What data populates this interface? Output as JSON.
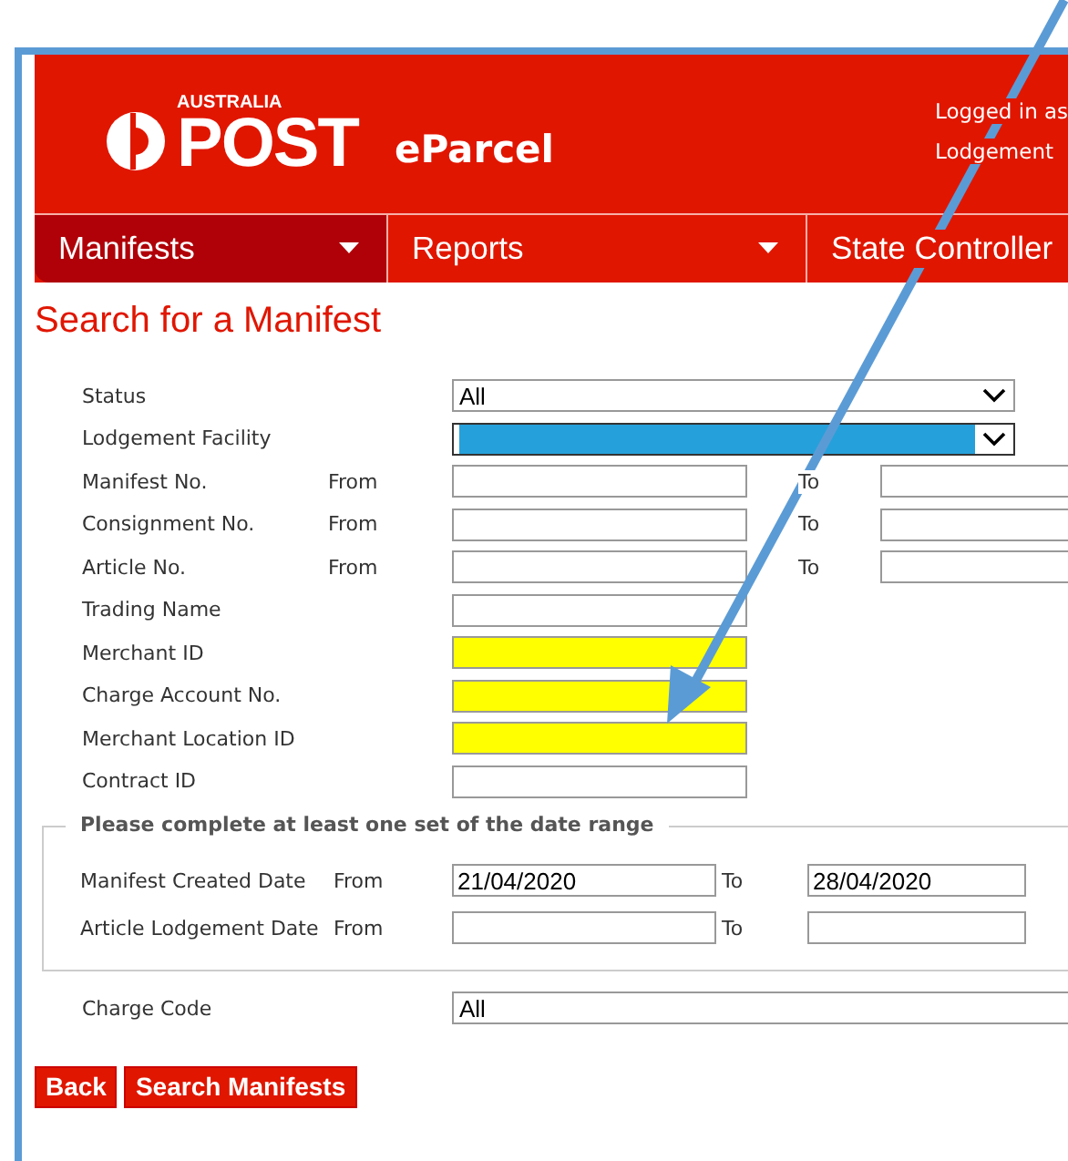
{
  "header": {
    "logo_small": "AUSTRALIA",
    "logo_main": "POST",
    "product": "eParcel",
    "user_lines": [
      "Logged in as",
      "Lodgement"
    ]
  },
  "nav": [
    {
      "label": "Manifests",
      "selected": true,
      "dropdown": true
    },
    {
      "label": "Reports",
      "selected": false,
      "dropdown": true
    },
    {
      "label": "State Controller",
      "selected": false
    }
  ],
  "title": "Search for a Manifest",
  "fields": [
    {
      "kind": "select",
      "label": "Status",
      "value": "All",
      "focused": false
    },
    {
      "kind": "select",
      "label": "Lodgement Facility",
      "focused": true
    },
    {
      "kind": "range",
      "label": "Manifest No.",
      "from": "From",
      "to": "To"
    },
    {
      "kind": "range",
      "label": "Consignment No.",
      "from": "From",
      "to": "To"
    },
    {
      "kind": "range",
      "label": "Article No.",
      "from": "From",
      "to": "To"
    },
    {
      "kind": "text",
      "label": "Trading Name",
      "highlighted": false
    },
    {
      "kind": "text",
      "label": "Merchant ID",
      "highlighted": true
    },
    {
      "kind": "text",
      "label": "Charge Account No.",
      "highlighted": true
    },
    {
      "kind": "text",
      "label": "Merchant Location ID",
      "highlighted": true
    },
    {
      "kind": "text",
      "label": "Contract ID",
      "highlighted": false
    }
  ],
  "date_range": {
    "legend": "Please complete at least one set of the date range",
    "rows": [
      {
        "label": "Manifest Created Date",
        "from": "From",
        "from_value": "21/04/2020",
        "to": "To",
        "to_value": "28/04/2020"
      },
      {
        "label": "Article Lodgement Date",
        "from": "From",
        "to": "To"
      }
    ]
  },
  "charge_code": {
    "label": "Charge Code",
    "value": "All"
  },
  "buttons": [
    "Back",
    "Search Manifests"
  ]
}
